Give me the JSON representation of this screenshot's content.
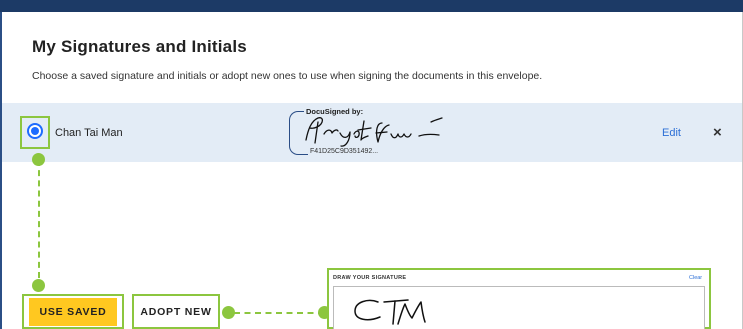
{
  "dialog": {
    "title": "My Signatures and Initials",
    "subtitle": "Choose a saved signature and initials or adopt new ones to use when signing the documents in this envelope."
  },
  "saved_signature": {
    "selected": true,
    "name": "Chan Tai Man",
    "docusigned_label": "DocuSigned by:",
    "signature_id": "F41D25C9D351492...",
    "edit_label": "Edit",
    "close_glyph": "×"
  },
  "actions": {
    "use_saved_label": "USE SAVED",
    "adopt_new_label": "ADOPT NEW"
  },
  "draw_panel": {
    "label": "DRAW YOUR SIGNATURE",
    "clear_label": "Clear"
  },
  "colors": {
    "accent_blue": "#1e6cff",
    "link_blue": "#2c6fd6",
    "row_highlight": "#e3ecf6",
    "annotation_green": "#8cc63f",
    "primary_button": "#ffc820",
    "header_bar": "#1c3a66"
  },
  "icons": {
    "radio": "radio-selected-icon",
    "close": "close-icon"
  }
}
